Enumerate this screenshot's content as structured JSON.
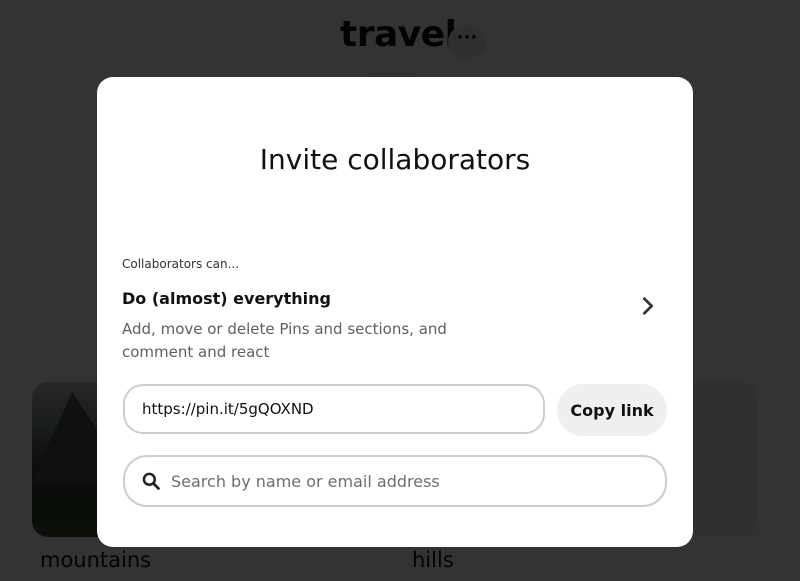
{
  "board": {
    "title": "travel",
    "more_label": "···",
    "cards": [
      {
        "label": "mountains"
      },
      {
        "label": "hills"
      }
    ]
  },
  "modal": {
    "title": "Invite collaborators",
    "permissions": {
      "caption": "Collaborators can...",
      "heading": "Do (almost) everything",
      "description": "Add, move or delete Pins and sections, and comment and react",
      "chevron_icon": "chevron-right-icon"
    },
    "share": {
      "link_value": "https://pin.it/5gQOXND",
      "copy_label": "Copy link"
    },
    "search": {
      "placeholder": "Search by name or email address",
      "icon": "search-icon"
    }
  },
  "colors": {
    "overlay": "#000000cc",
    "modal_bg": "#ffffff",
    "button_bg": "#efefef",
    "border": "#cdcdcd"
  }
}
